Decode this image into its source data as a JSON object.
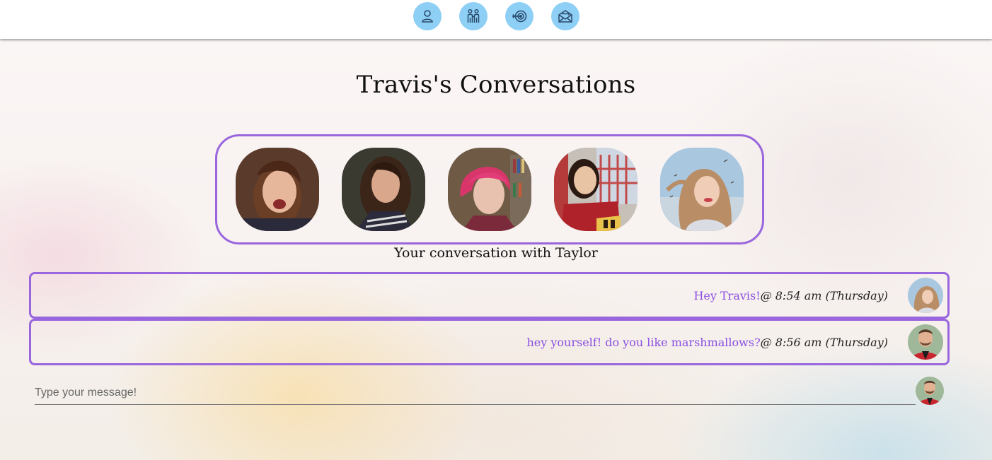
{
  "nav": {
    "items": [
      {
        "icon": "person-icon"
      },
      {
        "icon": "couple-icon"
      },
      {
        "icon": "target-icon"
      },
      {
        "icon": "mail-icon"
      }
    ],
    "button_color": "#8ecff6"
  },
  "page": {
    "title": "Travis's Conversations",
    "conversation_with": "Your conversation with Taylor"
  },
  "accent_color": "#9966dd",
  "message_color": "#8a4fe0",
  "messages": [
    {
      "text": "Hey Travis!",
      "meta": "@ 8:54 am (Thursday)"
    },
    {
      "text": "hey yourself! do you like marshmallows?",
      "meta": "@ 8:56 am (Thursday)"
    }
  ],
  "composer": {
    "placeholder": "Type your message!"
  }
}
